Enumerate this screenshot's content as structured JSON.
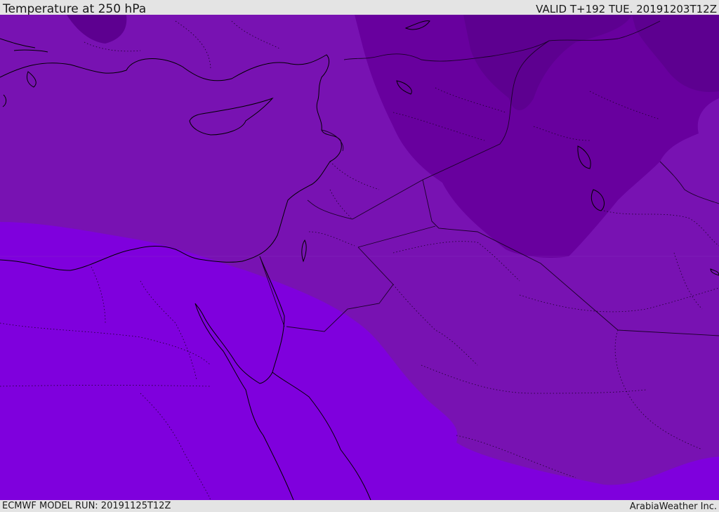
{
  "header": {
    "title": "Temperature at 250 hPa",
    "valid_time": "VALID T+192 TUE. 20191203T12Z"
  },
  "footer": {
    "model_run": "ECMWF MODEL RUN: 20191125T12Z",
    "credit": "ArabiaWeather Inc."
  },
  "colors": {
    "band_coldest": "#5d0090",
    "band_cold": "#68009e",
    "band_mid": "#7812b2",
    "band_warm": "#7f00dd",
    "coastline": "#000000",
    "border": "#1a0028"
  }
}
